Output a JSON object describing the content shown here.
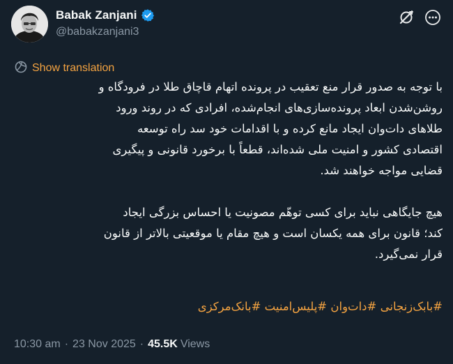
{
  "author": {
    "display_name": "Babak Zanjani",
    "handle": "@babakzanjani3",
    "verified": true,
    "verified_color": "#1d9bf0"
  },
  "actions": {
    "grok_icon": "grok-icon",
    "more_icon": "more-icon"
  },
  "translation": {
    "label": "Show translation",
    "icon": "globe-icon",
    "color": "#f4a341"
  },
  "tweet": {
    "lines": [
      "با توجه به صدور قرار منع تعقیب در پرونده اتهام قاچاق طلا در فرودگاه و",
      "روشن‌شدن ابعاد پرونده‌سازی‌های انجام‌شده، افرادی که در روند ورود",
      "طلاهای دات‌وان ایجاد مانع کرده و با اقدامات خود سد راه توسعه",
      "اقتصادی کشور و امنیت ملی شده‌اند، قطعاً با برخورد قانونی و پیگیری",
      "قضایی مواجه خواهند شد."
    ],
    "lines2": [
      "هیچ جایگاهی نباید برای کسی توهّم مصونیت یا احساس بزرگی ایجاد",
      "کند؛ قانون برای همه یکسان است و هیچ مقام یا موقعیتی بالاتر از قانون",
      "قرار نمی‌گیرد."
    ],
    "hashtags": [
      "#بابک‌زنجانی",
      "#دات‌وان",
      "#پلیس‌امنیت",
      "#بانک‌مرکزی"
    ]
  },
  "meta": {
    "time": "10:30 am",
    "separator": "·",
    "date": "23 Nov 2025",
    "views_count": "45.5K",
    "views_label": "Views"
  }
}
